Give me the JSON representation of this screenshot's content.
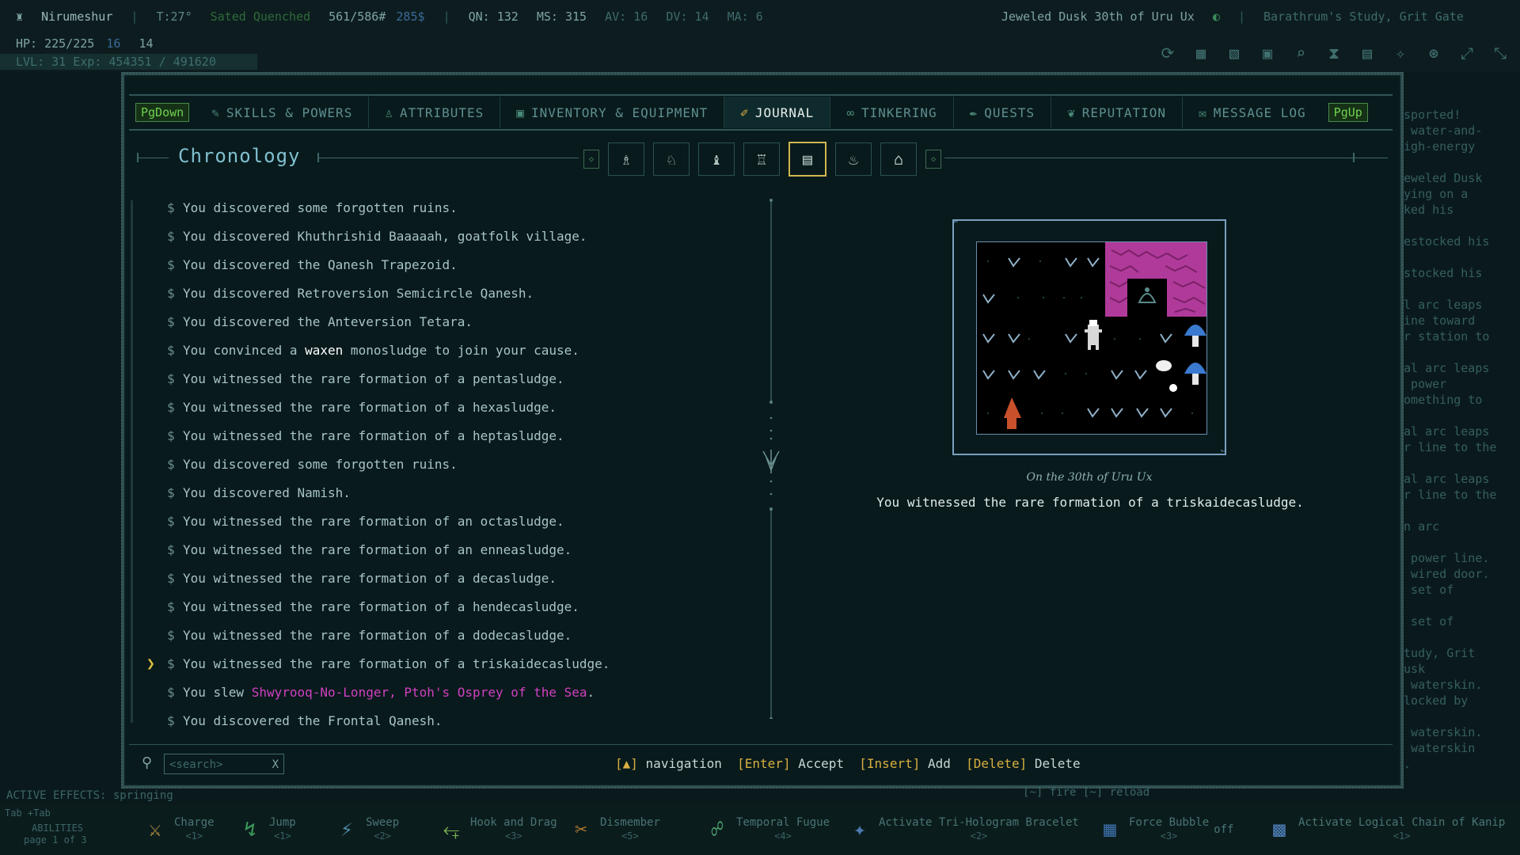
{
  "hud": {
    "name": "Nirumeshur",
    "temp": "T:27°",
    "hunger": "Sated Quenched",
    "weight": "561/586#",
    "money": "285$",
    "qn": "QN: 132",
    "ms": "MS: 315",
    "av": "AV: 16",
    "dv": "DV: 14",
    "ma": "MA: 6",
    "date": "Jeweled Dusk 30th of Uru Ux",
    "location": "Barathrum's Study, Grit Gate",
    "hp": "HP: 225/225",
    "hp_extra": "16",
    "hp_extra2": "14",
    "lvl": "LVL: 31 Exp: 454351 / 491620"
  },
  "tabs": [
    {
      "label": "SKILLS & POWERS",
      "icon": "skills-icon"
    },
    {
      "label": "ATTRIBUTES",
      "icon": "attributes-icon"
    },
    {
      "label": "INVENTORY & EQUIPMENT",
      "icon": "inventory-icon"
    },
    {
      "label": "JOURNAL",
      "icon": "journal-icon"
    },
    {
      "label": "TINKERING",
      "icon": "tinkering-icon"
    },
    {
      "label": "QUESTS",
      "icon": "quests-icon"
    },
    {
      "label": "REPUTATION",
      "icon": "reputation-icon"
    },
    {
      "label": "MESSAGE LOG",
      "icon": "message-log-icon"
    }
  ],
  "pg_down": "PgDown",
  "pg_up": "PgUp",
  "section_title": "Chronology",
  "entries": [
    {
      "pre": "You discovered some forgotten ruins.",
      "hl": "",
      "post": ""
    },
    {
      "pre": "You discovered Khuthrishid Baaaaah, goatfolk village.",
      "hl": "",
      "post": ""
    },
    {
      "pre": "You discovered the Qanesh Trapezoid.",
      "hl": "",
      "post": ""
    },
    {
      "pre": "You discovered Retroversion Semicircle Qanesh.",
      "hl": "",
      "post": ""
    },
    {
      "pre": "You discovered the Anteversion Tetara.",
      "hl": "",
      "post": ""
    },
    {
      "pre": "You convinced a ",
      "hl": "waxen",
      "hlclass": "hl-white",
      "post": " monosludge to join your cause."
    },
    {
      "pre": "You witnessed the rare formation of a pentasludge.",
      "hl": "",
      "post": ""
    },
    {
      "pre": "You witnessed the rare formation of a hexasludge.",
      "hl": "",
      "post": ""
    },
    {
      "pre": "You witnessed the rare formation of a heptasludge.",
      "hl": "",
      "post": ""
    },
    {
      "pre": "You discovered some forgotten ruins.",
      "hl": "",
      "post": ""
    },
    {
      "pre": "You discovered Namish.",
      "hl": "",
      "post": ""
    },
    {
      "pre": "You witnessed the rare formation of an octasludge.",
      "hl": "",
      "post": ""
    },
    {
      "pre": "You witnessed the rare formation of an enneasludge.",
      "hl": "",
      "post": ""
    },
    {
      "pre": "You witnessed the rare formation of a decasludge.",
      "hl": "",
      "post": ""
    },
    {
      "pre": "You witnessed the rare formation of a hendecasludge.",
      "hl": "",
      "post": ""
    },
    {
      "pre": "You witnessed the rare formation of a dodecasludge.",
      "hl": "",
      "post": ""
    },
    {
      "pre": "You witnessed the rare formation of a triskaidecasludge.",
      "hl": "",
      "post": "",
      "selected": true
    },
    {
      "pre": "You slew ",
      "hl": "Shwyrooq-No-Longer, Ptoh's Osprey of the Sea",
      "hlclass": "hl-magenta",
      "post": "."
    },
    {
      "pre": "You discovered the Frontal Qanesh.",
      "hl": "",
      "post": ""
    }
  ],
  "detail": {
    "date": "On the 30th of Uru Ux",
    "text": "You witnessed the rare formation of a triskaidecasludge."
  },
  "search": {
    "placeholder": "<search>",
    "clear": "X"
  },
  "hints": {
    "nav": "navigation",
    "enter_key": "[Enter]",
    "enter_label": "Accept",
    "insert_key": "[Insert]",
    "insert_label": "Add",
    "delete_key": "[Delete]",
    "delete_label": "Delete"
  },
  "right_log": [
    "nsported!",
    "a water-and-",
    "high-energy",
    "",
    "Jeweled Dusk",
    "lying on a",
    "cked his",
    "",
    "restocked his",
    "",
    "estocked his",
    "",
    "al arc leaps",
    "line toward",
    "er station to",
    "",
    "cal arc leaps",
    "n power",
    "something to",
    "",
    "cal arc leaps",
    "er line to the",
    "",
    "cal arc leaps",
    "er line to the",
    "",
    "an arc",
    "",
    "a power line.",
    "a wired door.",
    "a set of",
    "",
    "a set of",
    "",
    "Study, Grit",
    "Dusk",
    "a waterskin.",
    "blocked by",
    "",
    "a waterskin.",
    "e waterskin",
    "s."
  ],
  "effects": "ACTIVE EFFECTS: springing",
  "fire": "[~] fire  [~] reload",
  "abilities_nav": {
    "tab": "Tab",
    "shift_tab": "+Tab",
    "label": "ABILITIES",
    "page": "page 1 of 3"
  },
  "abilities": [
    {
      "name": "Charge",
      "key": "<1>"
    },
    {
      "name": "Jump",
      "key": "<1>"
    },
    {
      "name": "Sweep",
      "key": "<2>"
    },
    {
      "name": "Hook and Drag",
      "key": "<3>"
    },
    {
      "name": "Dismember",
      "key": "<5>"
    },
    {
      "name": "Temporal Fugue",
      "key": "<4>"
    },
    {
      "name": "Activate Tri-Hologram Bracelet",
      "key": "<2>"
    },
    {
      "name": "Force Bubble",
      "key": "<3>",
      "state": "off"
    },
    {
      "name": "Activate Logical Chain of Kanip",
      "key": "<1>"
    }
  ]
}
